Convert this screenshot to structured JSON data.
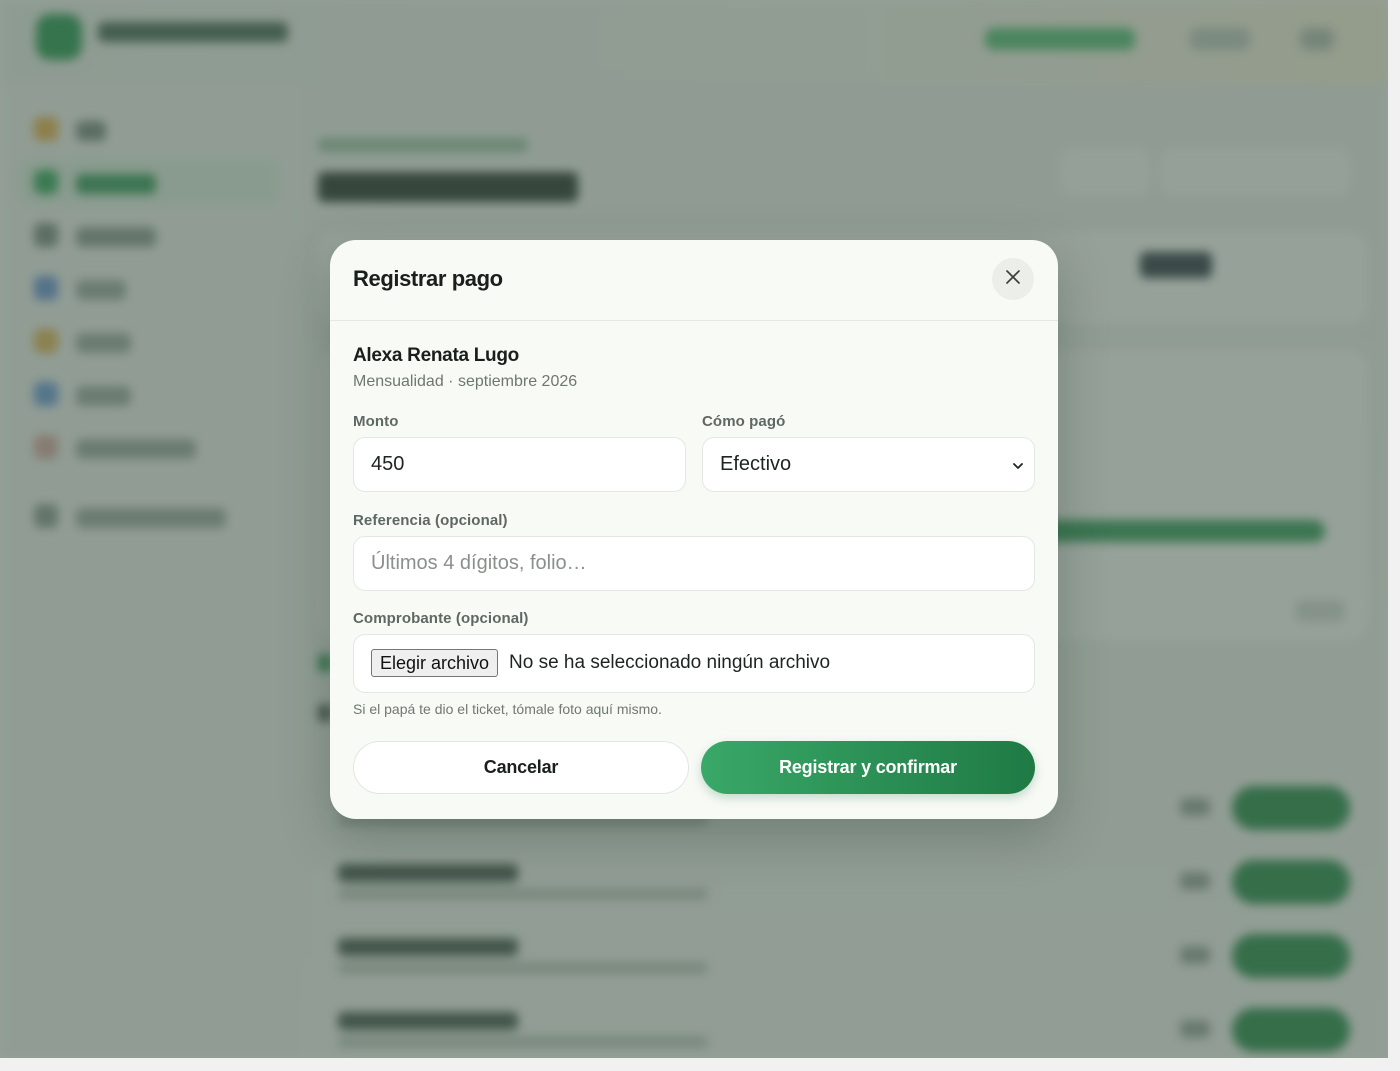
{
  "modal": {
    "title": "Registrar pago",
    "close_icon": "close-icon",
    "student_name": "Alexa Renata Lugo",
    "student_detail": "Mensualidad · septiembre 2026",
    "amount": {
      "label": "Monto",
      "value": "450"
    },
    "method": {
      "label": "Cómo pagó",
      "selected": "Efectivo"
    },
    "reference": {
      "label": "Referencia (opcional)",
      "placeholder": "Últimos 4 dígitos, folio…"
    },
    "receipt": {
      "label": "Comprobante (opcional)",
      "choose_button": "Elegir archivo",
      "no_file_text": "No se ha seleccionado ningún archivo",
      "hint": "Si el papá te dio el ticket, tómale foto aquí mismo."
    },
    "cancel_label": "Cancelar",
    "confirm_label": "Registrar y confirmar"
  },
  "colors": {
    "accent_green": "#2e8d4f",
    "confirm_gradient_start": "#39a868",
    "confirm_gradient_end": "#1f7a44",
    "overlay": "rgba(62,82,70,0.52)",
    "modal_bg": "#f8faf6"
  }
}
